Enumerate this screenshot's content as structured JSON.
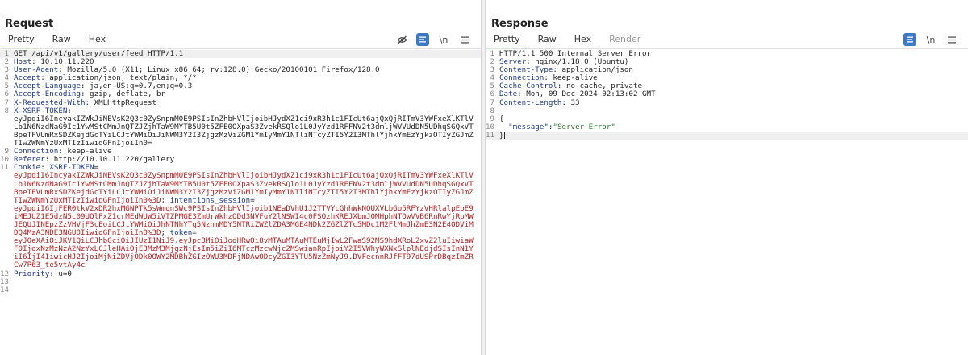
{
  "request": {
    "title": "Request",
    "tabs": [
      {
        "label": "Pretty",
        "active": true
      },
      {
        "label": "Raw",
        "active": false
      },
      {
        "label": "Hex",
        "active": false
      }
    ],
    "newline_toggle": "\\n",
    "lines": {
      "l1": "GET /api/v1/gallery/user/feed HTTP/1.1",
      "l2_k": "Host",
      "l2_v": ": 10.10.11.220",
      "l3_k": "User-Agent",
      "l3_v": ": Mozilla/5.0 (X11; Linux x86_64; rv:128.0) Gecko/20100101 Firefox/128.0",
      "l4_k": "Accept",
      "l4_v": ": application/json, text/plain, */*",
      "l5_k": "Accept-Language",
      "l5_v": ": ja,en-US;q=0.7,en;q=0.3",
      "l6_k": "Accept-Encoding",
      "l6_v": ": gzip, deflate, br",
      "l7_k": "X-Requested-With",
      "l7_v": ": XMLHttpRequest",
      "l8_k": "X-XSRF-TOKEN",
      "l8_v": ":",
      "l8_val": "eyJpdiI6IncyakIZWkJiNEVsK2Q3c0ZySnpmM0E9PSIsInZhbHVlIjoibHJydXZ1ci9xR3h1c1FIcUt6ajQxQjRITmV3YWFxeXlKTlVLb1N6NzdNaG9Ic1YwMStCMmJnQTZJZjhTaW9MYTB5U0t5ZFE0OXpaS3ZvekRSQlo1L0JyYzd1RFFNV2t3dmljWVVUdDN5UDhqSGQxVTBpeTFVUmRxSDZKejdGcTYiLCJtYWMiOiJiNWM3Y2I3ZjgzMzViZGM1YmIyMmY1NTliNTcyZTI5Y2I3MThlYjhkYmEzYjkzOTIyZGJmZTIwZWNmYzUxMTIzIiwidGFnIjoiIn0=",
      "l9_k": "Connection",
      "l9_v": ": keep-alive",
      "l10_k": "Referer",
      "l10_v": ": http://10.10.11.220/gallery",
      "l11_k": "Cookie",
      "l11_v": ": ",
      "c1_name": "XSRF-TOKEN",
      "c1_eq": "=",
      "c1_val": "eyJpdiI6IncyakIZWkJiNEVsK2Q3c0ZySnpmM0E9PSIsInZhbHVlIjoibHJydXZ1ci9xR3h1c1FIcUt6ajQxQjRITmV3YWFxeXlKTlVLb1N6NzdNaG9Ic1YwMStCMmJnQTZJZjhTaW9MYTB5U0t5ZFE0OXpaS3ZvekRSQlo1L0JyYzd1RFFNV2t3dmljWVVUdDN5UDhqSGQxVTBpeTFVUmRxSDZKejdGcTYiLCJtYWMiOiJiNWM3Y2I3ZjgzMzViZGM1YmIyMmY1NTliNTcyZTI5Y2I3MThlYjhkYmEzYjkzOTIyZGJmZTIwZWNmYzUxMTIzIiwidGFnIjoiIn0%3D",
      "c1_sep": "; ",
      "c2_name": "intentions_session",
      "c2_eq": "=",
      "c2_val": "eyJpdiI6IjFER0tkV2xDR2hxMGNPTk5sWmdnSWc9PSIsInZhbHVlIjoib1NEaDVhU1J2TTVYcGhhWkNOUXVLbGo5RFYzVHRlalpEbE9iMEJUZ1E5dzN5c09UQlFxZ1crMEdWUW5iVTZPMGE3ZmUrWkhzODd3NVFuY2lNSWI4c0FSQzhKREJXbmJQMHphNTQwVVB6RnRwYjRpMWJEQUJINEpzZzVHVjF3cEoiLCJtYWMiOiJhNTNhYTg5NzhmMDY5NTRiZWZlZDA3MGE4NDk2ZGZlZTc5MDc1M2FlMmJhZmE3N2E4ODViMDQ4MzA3NDE3NGU0IiwidGFnIjoiIn0%3D",
      "c2_sep": "; ",
      "c3_name": "token",
      "c3_eq": "=",
      "c3_val": "eyJ0eXAiOiJKV1QiLCJhbGciOiJIUzI1NiJ9.eyJpc3MiOiJodHRwOi8vMTAuMTAuMTEuMjIwL2FwaS92MS9hdXRoL2xvZ2luIiwiaWF0IjoxNzMzNzA2NzYxLCJleHAiOjE3MzM3MjgzNjEsIm5iZiI6MTczMzcwNjc2MSwianRpIjoiY2I5VWhyWXNxSlplNEdjdSIsInN1YiI6IjI4IiwicHJ2IjoiMjNiZDVjODk0OWY2MDBhZGIzOWU3MDFjNDAwODcyZGI3YTU5NzZmNyJ9.DVFecnnRJfFT97dUSPrDBqzImZRCw7P63_te5vtAy4c",
      "l12_k": "Priority",
      "l12_v": ": u=0",
      "l13": "",
      "l14": ""
    }
  },
  "response": {
    "title": "Response",
    "tabs": [
      {
        "label": "Pretty",
        "active": true
      },
      {
        "label": "Raw",
        "active": false
      },
      {
        "label": "Hex",
        "active": false
      },
      {
        "label": "Render",
        "active": false,
        "disabled": true
      }
    ],
    "newline_toggle": "\\n",
    "lines": {
      "l1": "HTTP/1.1 500 Internal Server Error",
      "l2_k": "Server",
      "l2_v": ": nginx/1.18.0 (Ubuntu)",
      "l3_k": "Content-Type",
      "l3_v": ": application/json",
      "l4_k": "Connection",
      "l4_v": ": keep-alive",
      "l5_k": "Cache-Control",
      "l5_v": ": no-cache, private",
      "l6_k": "Date",
      "l6_v": ": Mon, 09 Dec 2024 02:13:02 GMT",
      "l7_k": "Content-Length",
      "l7_v": ": 33",
      "l8": "",
      "l9": "{",
      "l10_key": "\"message\"",
      "l10_colon": ":",
      "l10_val": "\"Server Error\"",
      "l11": "}"
    }
  },
  "colors": {
    "accent_tab": "#ff6633",
    "header_key": "#1d3a8a",
    "cookie_value": "#b22222",
    "toggle_on": "#3c78c4"
  }
}
